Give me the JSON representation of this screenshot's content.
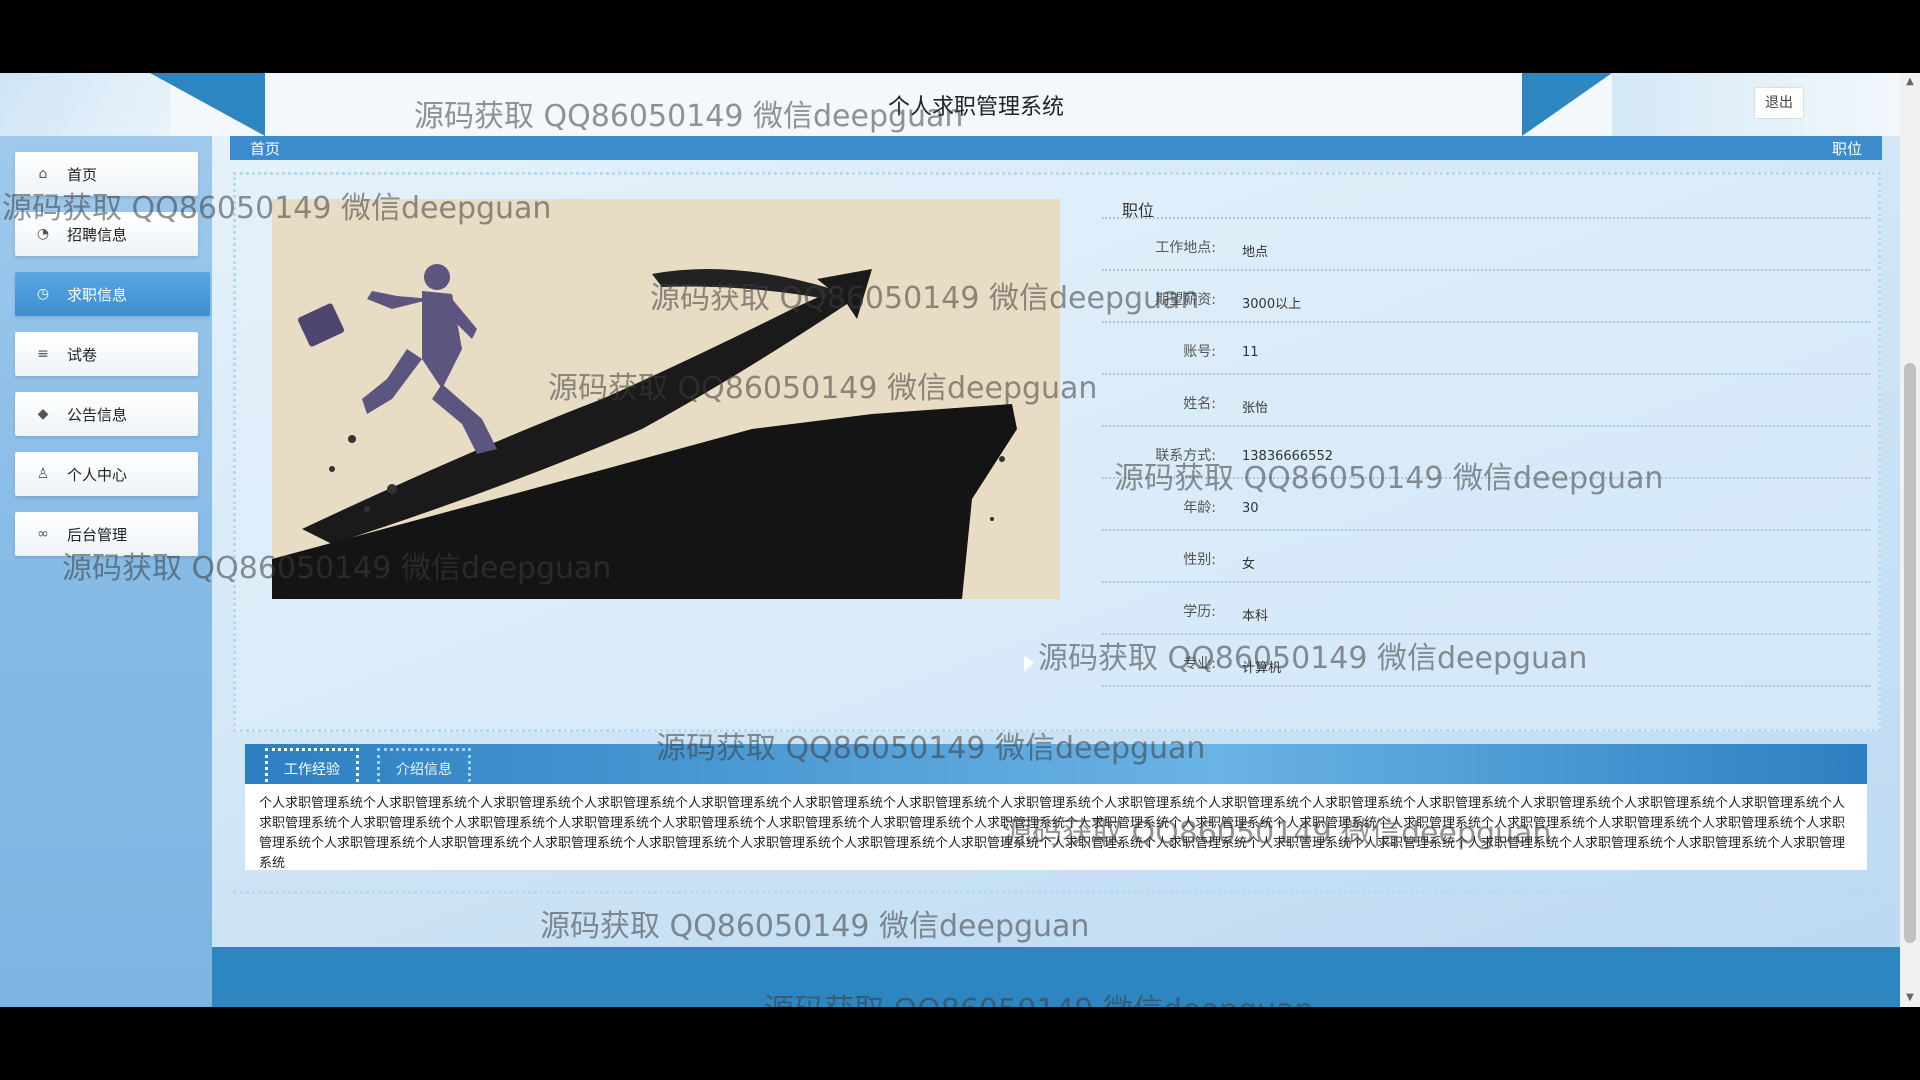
{
  "header": {
    "title": "个人求职管理系统",
    "logout_label": "退出"
  },
  "sidebar": {
    "items": [
      {
        "label": "首页",
        "icon": "home-icon",
        "glyph": "⌂"
      },
      {
        "label": "招聘信息",
        "icon": "palette-icon",
        "glyph": "◔"
      },
      {
        "label": "求职信息",
        "icon": "clock-icon",
        "glyph": "◷"
      },
      {
        "label": "试卷",
        "icon": "sliders-icon",
        "glyph": "≡"
      },
      {
        "label": "公告信息",
        "icon": "layers-icon",
        "glyph": "◆"
      },
      {
        "label": "个人中心",
        "icon": "user-icon",
        "glyph": "♙"
      },
      {
        "label": "后台管理",
        "icon": "link-icon",
        "glyph": "∞"
      }
    ],
    "active_index": 2
  },
  "breadcrumb": {
    "left": "首页",
    "right": "职位"
  },
  "detail": {
    "heading": "职位",
    "fields": [
      {
        "label": "工作地点:",
        "value": "地点"
      },
      {
        "label": "期望薪资:",
        "value": "3000以上"
      },
      {
        "label": "账号:",
        "value": "11"
      },
      {
        "label": "姓名:",
        "value": "张怡"
      },
      {
        "label": "联系方式:",
        "value": "13836666552"
      },
      {
        "label": "年龄:",
        "value": "30"
      },
      {
        "label": "性别:",
        "value": "女"
      },
      {
        "label": "学历:",
        "value": "本科"
      },
      {
        "label": "专业:",
        "value": "计算机"
      }
    ]
  },
  "tabs": {
    "items": [
      "工作经验",
      "介绍信息"
    ],
    "active_index": 0,
    "content": "个人求职管理系统个人求职管理系统个人求职管理系统个人求职管理系统个人求职管理系统个人求职管理系统个人求职管理系统个人求职管理系统个人求职管理系统个人求职管理系统个人求职管理系统个人求职管理系统个人求职管理系统个人求职管理系统个人求职管理系统个人求职管理系统个人求职管理系统个人求职管理系统个人求职管理系统个人求职管理系统个人求职管理系统个人求职管理系统个人求职管理系统个人求职管理系统个人求职管理系统个人求职管理系统个人求职管理系统个人求职管理系统个人求职管理系统个人求职管理系统个人求职管理系统个人求职管理系统个人求职管理系统个人求职管理系统个人求职管理系统个人求职管理系统个人求职管理系统个人求职管理系统个人求职管理系统个人求职管理系统个人求职管理系统个人求职管理系统个人求职管理系统个人求职管理系统个人求职管理系统个人求职管理系统"
  },
  "watermark": {
    "text": "源码获取 QQ86050149 微信deepguan"
  },
  "colors": {
    "primary_blue": "#2e86c1",
    "active_menu": "#3c8fd2",
    "sidebar_bg": "#86bbe6"
  }
}
